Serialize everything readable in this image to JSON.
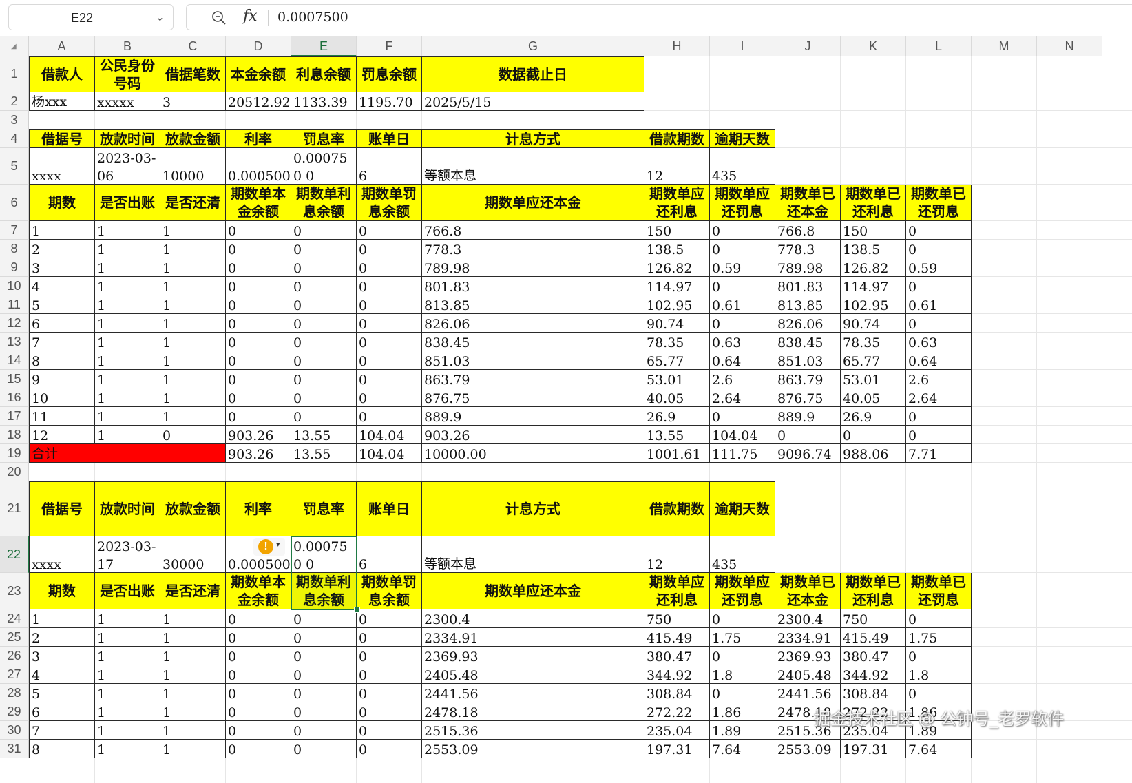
{
  "toolbar": {
    "name_box": "E22",
    "fx_label": "fx",
    "formula_value": "0.0007500"
  },
  "columns": [
    "A",
    "B",
    "C",
    "D",
    "E",
    "F",
    "G",
    "H",
    "I",
    "J",
    "K",
    "L",
    "M",
    "N"
  ],
  "selected_column": "E",
  "selected_row": 22,
  "row_numbers": [
    "1",
    "2",
    "3",
    "4",
    "5",
    "6",
    "7",
    "8",
    "9",
    "10",
    "11",
    "12",
    "13",
    "14",
    "15",
    "16",
    "17",
    "18",
    "19",
    "20",
    "21",
    "22",
    "23",
    "24",
    "25",
    "26",
    "27",
    "28",
    "29",
    "30",
    "31"
  ],
  "sheet": {
    "r1": [
      "借款人",
      "公民身份号码",
      "借据笔数",
      "本金余额",
      "利息余额",
      "罚息余额",
      "数据截止日"
    ],
    "r2": [
      "杨xxx",
      "xxxxx",
      "3",
      "20512.92",
      "1133.39",
      "1195.70",
      "2025/5/15"
    ],
    "r4": [
      "借据号",
      "放款时间",
      "放款金额",
      "利率",
      "罚息率",
      "账单日",
      "计息方式",
      "借款期数",
      "逾期天数"
    ],
    "r5": [
      "xxxx",
      "2023-03-06",
      "10000",
      "0.000500",
      "0.000750 0",
      "6",
      "等额本息",
      "12",
      "435"
    ],
    "r6": [
      "期数",
      "是否出账",
      "是否还清",
      "期数单本金余额",
      "期数单利息余额",
      "期数单罚息余额",
      "期数单应还本金",
      "期数单应还利息",
      "期数单应还罚息",
      "期数单已还本金",
      "期数单已还利息",
      "期数单已还罚息"
    ],
    "block1": [
      [
        "1",
        "1",
        "1",
        "0",
        "0",
        "0",
        "766.8",
        "150",
        "0",
        "766.8",
        "150",
        "0"
      ],
      [
        "2",
        "1",
        "1",
        "0",
        "0",
        "0",
        "778.3",
        "138.5",
        "0",
        "778.3",
        "138.5",
        "0"
      ],
      [
        "3",
        "1",
        "1",
        "0",
        "0",
        "0",
        "789.98",
        "126.82",
        "0.59",
        "789.98",
        "126.82",
        "0.59"
      ],
      [
        "4",
        "1",
        "1",
        "0",
        "0",
        "0",
        "801.83",
        "114.97",
        "0",
        "801.83",
        "114.97",
        "0"
      ],
      [
        "5",
        "1",
        "1",
        "0",
        "0",
        "0",
        "813.85",
        "102.95",
        "0.61",
        "813.85",
        "102.95",
        "0.61"
      ],
      [
        "6",
        "1",
        "1",
        "0",
        "0",
        "0",
        "826.06",
        "90.74",
        "0",
        "826.06",
        "90.74",
        "0"
      ],
      [
        "7",
        "1",
        "1",
        "0",
        "0",
        "0",
        "838.45",
        "78.35",
        "0.63",
        "838.45",
        "78.35",
        "0.63"
      ],
      [
        "8",
        "1",
        "1",
        "0",
        "0",
        "0",
        "851.03",
        "65.77",
        "0.64",
        "851.03",
        "65.77",
        "0.64"
      ],
      [
        "9",
        "1",
        "1",
        "0",
        "0",
        "0",
        "863.79",
        "53.01",
        "2.6",
        "863.79",
        "53.01",
        "2.6"
      ],
      [
        "10",
        "1",
        "1",
        "0",
        "0",
        "0",
        "876.75",
        "40.05",
        "2.64",
        "876.75",
        "40.05",
        "2.64"
      ],
      [
        "11",
        "1",
        "1",
        "0",
        "0",
        "0",
        "889.9",
        "26.9",
        "0",
        "889.9",
        "26.9",
        "0"
      ],
      [
        "12",
        "1",
        "0",
        "903.26",
        "13.55",
        "104.04",
        "903.26",
        "13.55",
        "104.04",
        "0",
        "0",
        "0"
      ]
    ],
    "r19": [
      "合计",
      "903.26",
      "13.55",
      "104.04",
      "10000.00",
      "1001.61",
      "111.75",
      "9096.74",
      "988.06",
      "7.71"
    ],
    "r21": [
      "借据号",
      "放款时间",
      "放款金额",
      "利率",
      "罚息率",
      "账单日",
      "计息方式",
      "借款期数",
      "逾期天数"
    ],
    "r22": [
      "xxxx",
      "2023-03-17",
      "30000",
      "0.000500",
      "0.000750 0",
      "6",
      "等额本息",
      "12",
      "435"
    ],
    "r23": [
      "期数",
      "是否出账",
      "是否还清",
      "期数单本金余额",
      "期数单利息余额",
      "期数单罚息余额",
      "期数单应还本金",
      "期数单应还利息",
      "期数单应还罚息",
      "期数单已还本金",
      "期数单已还利息",
      "期数单已还罚息"
    ],
    "block2": [
      [
        "1",
        "1",
        "1",
        "0",
        "0",
        "0",
        "2300.4",
        "750",
        "0",
        "2300.4",
        "750",
        "0"
      ],
      [
        "2",
        "1",
        "1",
        "0",
        "0",
        "0",
        "2334.91",
        "415.49",
        "1.75",
        "2334.91",
        "415.49",
        "1.75"
      ],
      [
        "3",
        "1",
        "1",
        "0",
        "0",
        "0",
        "2369.93",
        "380.47",
        "0",
        "2369.93",
        "380.47",
        "0"
      ],
      [
        "4",
        "1",
        "1",
        "0",
        "0",
        "0",
        "2405.48",
        "344.92",
        "1.8",
        "2405.48",
        "344.92",
        "1.8"
      ],
      [
        "5",
        "1",
        "1",
        "0",
        "0",
        "0",
        "2441.56",
        "308.84",
        "0",
        "2441.56",
        "308.84",
        "0"
      ],
      [
        "6",
        "1",
        "1",
        "0",
        "0",
        "0",
        "2478.18",
        "272.22",
        "1.86",
        "2478.18",
        "272.22",
        "1.86"
      ],
      [
        "7",
        "1",
        "1",
        "0",
        "0",
        "0",
        "2515.36",
        "235.04",
        "1.89",
        "2515.36",
        "235.04",
        "1.89"
      ],
      [
        "8",
        "1",
        "1",
        "0",
        "0",
        "0",
        "2553.09",
        "197.31",
        "7.64",
        "2553.09",
        "197.31",
        "7.64"
      ]
    ]
  },
  "watermark": "掘金技术社区 @ 公钟号_老罗软件",
  "colors": {
    "header_fill": "#ffff00",
    "total_fill": "#ff0000",
    "selection": "#1f7a45"
  }
}
